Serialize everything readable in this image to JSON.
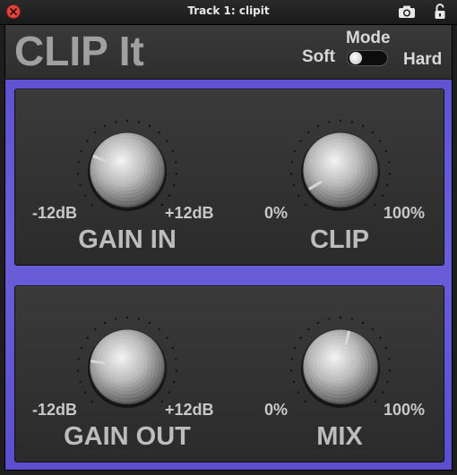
{
  "window": {
    "title": "Track 1: clipit",
    "icons": [
      "close-icon",
      "camera-icon",
      "lock-icon"
    ]
  },
  "plugin": {
    "logo": "CLIP It",
    "mode": {
      "label": "Mode",
      "left_label": "Soft",
      "right_label": "Hard",
      "value": "Soft"
    },
    "knobs": [
      {
        "id": "gain_in",
        "name": "GAIN IN",
        "min_label": "-12dB",
        "max_label": "+12dB",
        "value_fraction": 0.25
      },
      {
        "id": "clip",
        "name": "CLIP",
        "min_label": "0%",
        "max_label": "100%",
        "value_fraction": 0.05
      },
      {
        "id": "gain_out",
        "name": "GAIN OUT",
        "min_label": "-12dB",
        "max_label": "+12dB",
        "value_fraction": 0.2
      },
      {
        "id": "mix",
        "name": "MIX",
        "min_label": "0%",
        "max_label": "100%",
        "value_fraction": 0.55
      }
    ]
  },
  "colors": {
    "accent": "#6a5ed8",
    "panel": "#323232",
    "label": "#bdbdbd",
    "close": "#e0453f"
  }
}
